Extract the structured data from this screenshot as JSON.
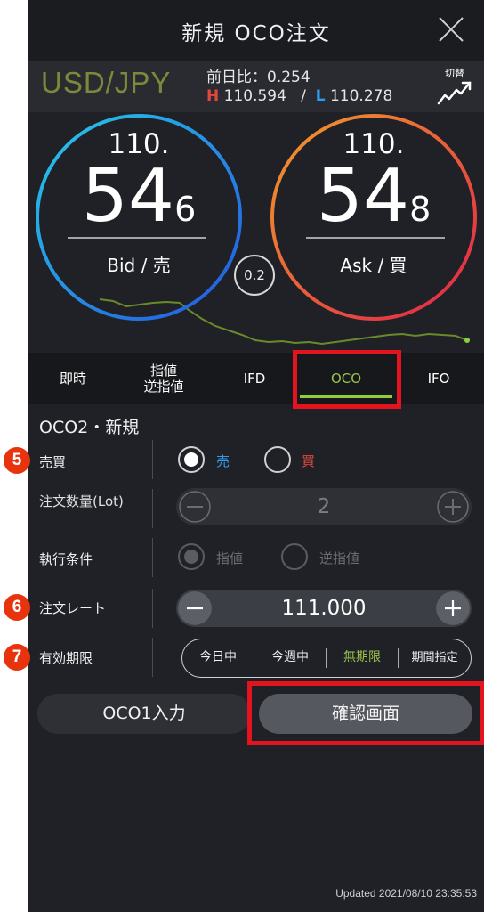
{
  "header": {
    "title": "新規 OCO注文"
  },
  "info": {
    "pair": "USD/JPY",
    "prev_change": "前日比：0.254",
    "high_label": "H",
    "high": "110.594",
    "sep": "/",
    "low_label": "L",
    "low": "110.278",
    "switch_label": "切替"
  },
  "bid": {
    "prefix": "110.",
    "main": "54",
    "pip": "6",
    "label": "Bid / 売"
  },
  "ask": {
    "prefix": "110.",
    "main": "54",
    "pip": "8",
    "label": "Ask / 買"
  },
  "spread": "0.2",
  "tabs": [
    {
      "label": "即時"
    },
    {
      "label": "指値\n逆指値"
    },
    {
      "label": "IFD"
    },
    {
      "label": "OCO"
    },
    {
      "label": "IFO"
    }
  ],
  "form": {
    "section_title": "OCO2・新規",
    "side": {
      "label": "売買",
      "sell": "売",
      "buy": "買"
    },
    "quantity": {
      "label": "注文数量(Lot)",
      "value": "2"
    },
    "condition": {
      "label": "執行条件",
      "limit": "指値",
      "stop": "逆指値"
    },
    "rate": {
      "label": "注文レート",
      "value": "111.000"
    },
    "expiry": {
      "label": "有効期限",
      "options": [
        "今日中",
        "今週中",
        "無期限",
        "期間指定"
      ],
      "selected": "無期限"
    }
  },
  "buttons": {
    "oco1": "OCO1入力",
    "confirm": "確認画面"
  },
  "updated": "Updated  2021/08/10 23:35:53",
  "badges": [
    "5",
    "6",
    "7"
  ],
  "colors": {
    "background": "#1f2127",
    "accent_green": "#9cc34a",
    "sell_blue": "#2f9cf0",
    "buy_red": "#e2483c",
    "highlight_red": "#e3141e"
  }
}
